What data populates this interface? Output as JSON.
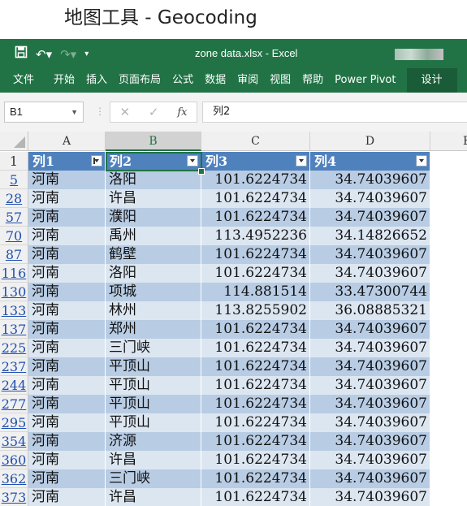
{
  "page_heading": "地图工具 - Geocoding",
  "window": {
    "title": "zone data.xlsx  -  Excel",
    "qat": {
      "save_icon": "save-icon",
      "undo_icon": "undo-icon",
      "redo_icon": "redo-icon",
      "customize_icon": "chevron-down-icon"
    },
    "tabs": [
      "文件",
      "开始",
      "插入",
      "页面布局",
      "公式",
      "数据",
      "审阅",
      "视图",
      "帮助",
      "Power Pivot",
      "设计"
    ],
    "active_tab": "设计"
  },
  "formula_bar": {
    "name_box": "B1",
    "cancel_glyph": "✕",
    "enter_glyph": "✓",
    "fx_label": "fx",
    "formula": "列2"
  },
  "grid": {
    "columns": [
      "A",
      "B",
      "C",
      "D"
    ],
    "next_column": "E",
    "selected_column": "B",
    "header_row_number": "1",
    "table_headers": [
      "列1",
      "列2",
      "列3",
      "列4"
    ],
    "rows": [
      {
        "row": "5",
        "province": "河南",
        "city": "洛阳",
        "lng": "101.6224734",
        "lat": "34.74039607"
      },
      {
        "row": "28",
        "province": "河南",
        "city": "许昌",
        "lng": "101.6224734",
        "lat": "34.74039607"
      },
      {
        "row": "57",
        "province": "河南",
        "city": "濮阳",
        "lng": "101.6224734",
        "lat": "34.74039607"
      },
      {
        "row": "70",
        "province": "河南",
        "city": "禹州",
        "lng": "113.4952236",
        "lat": "34.14826652"
      },
      {
        "row": "87",
        "province": "河南",
        "city": "鹤壁",
        "lng": "101.6224734",
        "lat": "34.74039607"
      },
      {
        "row": "116",
        "province": "河南",
        "city": "洛阳",
        "lng": "101.6224734",
        "lat": "34.74039607"
      },
      {
        "row": "130",
        "province": "河南",
        "city": "项城",
        "lng": "114.881514",
        "lat": "33.47300744"
      },
      {
        "row": "133",
        "province": "河南",
        "city": "林州",
        "lng": "113.8255902",
        "lat": "36.08885321"
      },
      {
        "row": "137",
        "province": "河南",
        "city": "郑州",
        "lng": "101.6224734",
        "lat": "34.74039607"
      },
      {
        "row": "225",
        "province": "河南",
        "city": "三门峡",
        "lng": "101.6224734",
        "lat": "34.74039607"
      },
      {
        "row": "237",
        "province": "河南",
        "city": "平顶山",
        "lng": "101.6224734",
        "lat": "34.74039607"
      },
      {
        "row": "244",
        "province": "河南",
        "city": "平顶山",
        "lng": "101.6224734",
        "lat": "34.74039607"
      },
      {
        "row": "277",
        "province": "河南",
        "city": "平顶山",
        "lng": "101.6224734",
        "lat": "34.74039607"
      },
      {
        "row": "295",
        "province": "河南",
        "city": "平顶山",
        "lng": "101.6224734",
        "lat": "34.74039607"
      },
      {
        "row": "354",
        "province": "河南",
        "city": "济源",
        "lng": "101.6224734",
        "lat": "34.74039607"
      },
      {
        "row": "360",
        "province": "河南",
        "city": "许昌",
        "lng": "101.6224734",
        "lat": "34.74039607"
      },
      {
        "row": "362",
        "province": "河南",
        "city": "三门峡",
        "lng": "101.6224734",
        "lat": "34.74039607"
      },
      {
        "row": "373",
        "province": "河南",
        "city": "许昌",
        "lng": "101.6224734",
        "lat": "34.74039607"
      }
    ]
  },
  "colors": {
    "excel_green": "#217346",
    "table_header": "#4f81bd",
    "band_dark": "#b8cce4",
    "band_light": "#dce6f1"
  }
}
